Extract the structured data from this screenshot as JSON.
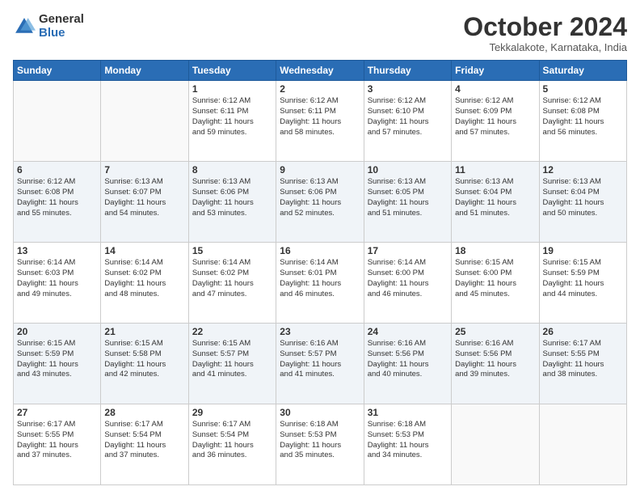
{
  "header": {
    "logo_general": "General",
    "logo_blue": "Blue",
    "month_title": "October 2024",
    "location": "Tekkalakote, Karnataka, India"
  },
  "days_of_week": [
    "Sunday",
    "Monday",
    "Tuesday",
    "Wednesday",
    "Thursday",
    "Friday",
    "Saturday"
  ],
  "weeks": [
    [
      {
        "day": "",
        "info": ""
      },
      {
        "day": "",
        "info": ""
      },
      {
        "day": "1",
        "info": "Sunrise: 6:12 AM\nSunset: 6:11 PM\nDaylight: 11 hours\nand 59 minutes."
      },
      {
        "day": "2",
        "info": "Sunrise: 6:12 AM\nSunset: 6:11 PM\nDaylight: 11 hours\nand 58 minutes."
      },
      {
        "day": "3",
        "info": "Sunrise: 6:12 AM\nSunset: 6:10 PM\nDaylight: 11 hours\nand 57 minutes."
      },
      {
        "day": "4",
        "info": "Sunrise: 6:12 AM\nSunset: 6:09 PM\nDaylight: 11 hours\nand 57 minutes."
      },
      {
        "day": "5",
        "info": "Sunrise: 6:12 AM\nSunset: 6:08 PM\nDaylight: 11 hours\nand 56 minutes."
      }
    ],
    [
      {
        "day": "6",
        "info": "Sunrise: 6:12 AM\nSunset: 6:08 PM\nDaylight: 11 hours\nand 55 minutes."
      },
      {
        "day": "7",
        "info": "Sunrise: 6:13 AM\nSunset: 6:07 PM\nDaylight: 11 hours\nand 54 minutes."
      },
      {
        "day": "8",
        "info": "Sunrise: 6:13 AM\nSunset: 6:06 PM\nDaylight: 11 hours\nand 53 minutes."
      },
      {
        "day": "9",
        "info": "Sunrise: 6:13 AM\nSunset: 6:06 PM\nDaylight: 11 hours\nand 52 minutes."
      },
      {
        "day": "10",
        "info": "Sunrise: 6:13 AM\nSunset: 6:05 PM\nDaylight: 11 hours\nand 51 minutes."
      },
      {
        "day": "11",
        "info": "Sunrise: 6:13 AM\nSunset: 6:04 PM\nDaylight: 11 hours\nand 51 minutes."
      },
      {
        "day": "12",
        "info": "Sunrise: 6:13 AM\nSunset: 6:04 PM\nDaylight: 11 hours\nand 50 minutes."
      }
    ],
    [
      {
        "day": "13",
        "info": "Sunrise: 6:14 AM\nSunset: 6:03 PM\nDaylight: 11 hours\nand 49 minutes."
      },
      {
        "day": "14",
        "info": "Sunrise: 6:14 AM\nSunset: 6:02 PM\nDaylight: 11 hours\nand 48 minutes."
      },
      {
        "day": "15",
        "info": "Sunrise: 6:14 AM\nSunset: 6:02 PM\nDaylight: 11 hours\nand 47 minutes."
      },
      {
        "day": "16",
        "info": "Sunrise: 6:14 AM\nSunset: 6:01 PM\nDaylight: 11 hours\nand 46 minutes."
      },
      {
        "day": "17",
        "info": "Sunrise: 6:14 AM\nSunset: 6:00 PM\nDaylight: 11 hours\nand 46 minutes."
      },
      {
        "day": "18",
        "info": "Sunrise: 6:15 AM\nSunset: 6:00 PM\nDaylight: 11 hours\nand 45 minutes."
      },
      {
        "day": "19",
        "info": "Sunrise: 6:15 AM\nSunset: 5:59 PM\nDaylight: 11 hours\nand 44 minutes."
      }
    ],
    [
      {
        "day": "20",
        "info": "Sunrise: 6:15 AM\nSunset: 5:59 PM\nDaylight: 11 hours\nand 43 minutes."
      },
      {
        "day": "21",
        "info": "Sunrise: 6:15 AM\nSunset: 5:58 PM\nDaylight: 11 hours\nand 42 minutes."
      },
      {
        "day": "22",
        "info": "Sunrise: 6:15 AM\nSunset: 5:57 PM\nDaylight: 11 hours\nand 41 minutes."
      },
      {
        "day": "23",
        "info": "Sunrise: 6:16 AM\nSunset: 5:57 PM\nDaylight: 11 hours\nand 41 minutes."
      },
      {
        "day": "24",
        "info": "Sunrise: 6:16 AM\nSunset: 5:56 PM\nDaylight: 11 hours\nand 40 minutes."
      },
      {
        "day": "25",
        "info": "Sunrise: 6:16 AM\nSunset: 5:56 PM\nDaylight: 11 hours\nand 39 minutes."
      },
      {
        "day": "26",
        "info": "Sunrise: 6:17 AM\nSunset: 5:55 PM\nDaylight: 11 hours\nand 38 minutes."
      }
    ],
    [
      {
        "day": "27",
        "info": "Sunrise: 6:17 AM\nSunset: 5:55 PM\nDaylight: 11 hours\nand 37 minutes."
      },
      {
        "day": "28",
        "info": "Sunrise: 6:17 AM\nSunset: 5:54 PM\nDaylight: 11 hours\nand 37 minutes."
      },
      {
        "day": "29",
        "info": "Sunrise: 6:17 AM\nSunset: 5:54 PM\nDaylight: 11 hours\nand 36 minutes."
      },
      {
        "day": "30",
        "info": "Sunrise: 6:18 AM\nSunset: 5:53 PM\nDaylight: 11 hours\nand 35 minutes."
      },
      {
        "day": "31",
        "info": "Sunrise: 6:18 AM\nSunset: 5:53 PM\nDaylight: 11 hours\nand 34 minutes."
      },
      {
        "day": "",
        "info": ""
      },
      {
        "day": "",
        "info": ""
      }
    ]
  ]
}
